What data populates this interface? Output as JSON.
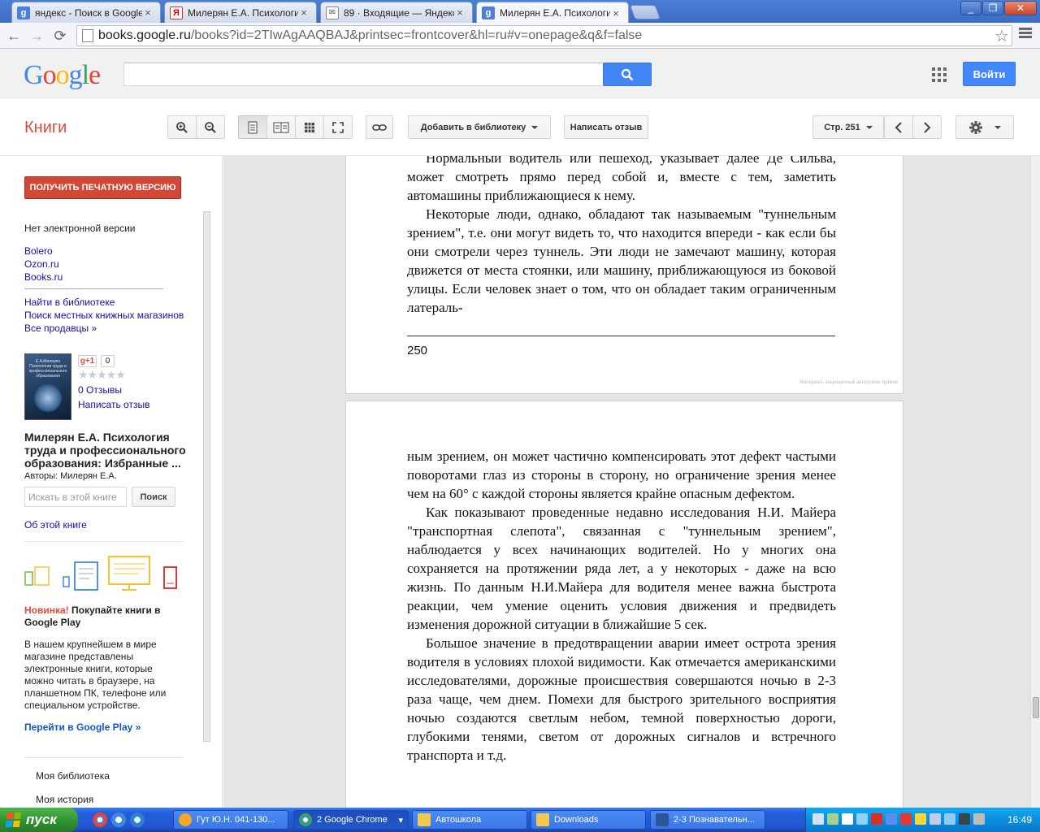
{
  "browser": {
    "tabs": [
      {
        "title": "яндекс - Поиск в Google",
        "favicon": "google-g-icon",
        "favicon_color": "#4d7fe0"
      },
      {
        "title": "Милерян Е.А. Психология т",
        "favicon": "yandex-icon",
        "favicon_color": "#ffffff"
      },
      {
        "title": "89 · Входящие — Яндекс.П",
        "favicon": "mail-icon",
        "favicon_color": "#ffffff"
      },
      {
        "title": "Милерян Е.А. Психология т",
        "favicon": "google-g-icon",
        "favicon_color": "#4d7fe0",
        "active": true
      }
    ],
    "url_host": "books.google.ru",
    "url_rest": "/books?id=2TIwAgAAQBAJ&printsec=frontcover&hl=ru#v=onepage&q&f=false"
  },
  "google": {
    "logo_letters": [
      "G",
      "o",
      "o",
      "g",
      "l",
      "e"
    ],
    "logo_colors": [
      "#4285f4",
      "#ea4335",
      "#fbbc05",
      "#4285f4",
      "#34a853",
      "#ea4335"
    ],
    "search_placeholder": "",
    "signin_label": "Войти"
  },
  "books_toolbar": {
    "section_title": "Книги",
    "add_to_library": "Добавить в библиотеку",
    "write_review": "Написать отзыв",
    "page_selector": "Стр. 251"
  },
  "sidebar": {
    "get_print": "ПОЛУЧИТЬ ПЕЧАТНУЮ ВЕРСИЮ",
    "no_ebook": "Нет электронной версии",
    "sellers": [
      "Bolero",
      "Ozon.ru",
      "Books.ru"
    ],
    "find_links": [
      "Найти в библиотеке",
      "Поиск местных книжных магазинов",
      "Все продавцы »"
    ],
    "cover_title": "Е.А.Милерян\nПсихология труда и профессионального образования",
    "gplus_label": "g+1",
    "gplus_count": "0",
    "stars": "★★★★★",
    "reviews_count": "0 Отзывы",
    "write_review": "Написать отзыв",
    "book_title": "Милерян Е.А. Психология труда и профессионального образования: Избранные ...",
    "authors": "Авторы: Милерян Е.А.",
    "search_in_book_placeholder": "Искать в этой книге",
    "search_button": "Поиск",
    "about_book": "Об этой книге",
    "promo_new": "Новинка!",
    "promo_headline": " Покупайте книги в Google Play",
    "promo_body": "В нашем крупнейшем в мире магазине представлены электронные книги, которые можно читать в браузере, на планшетном ПК, телефоне или специальном устройстве.",
    "promo_link": "Перейти в Google Play »",
    "bottom_links": [
      "Моя библиотека",
      "Моя история"
    ]
  },
  "reader": {
    "page1_paragraphs": [
      "Нормальный водитель или пешеход, указывает далее Де Сильва, может смотреть прямо перед собой и, вместе с тем, заметить автомашины приближающиеся к нему.",
      "Некоторые люди, однако, обладают так называемым \"туннельным зрением\", т.е. они могут видеть то, что находится впереди - как если бы они смотрели через туннель. Эти люди не замечают машину, которая движется от места стоянки, или машину, приближающуюся из боковой улицы. Если человек знает о том, что он обладает таким ограниченным латераль-"
    ],
    "page1_number": "250",
    "page1_copyright": "Материал, защищенный авторским правом",
    "page2_paragraphs": [
      "ным зрением, он может частично компенсировать этот дефект частыми поворотами глаз из стороны в сторону, но ограничение зрения менее чем на 60° с каждой стороны является крайне опасным дефектом.",
      "Как показывают проведенные недавно исследования Н.И. Майера \"транспортная слепота\", связанная с \"туннельным зрением\", наблюдается у всех начинающих водителей. Но у многих она сохраняется на протяжении ряда лет, а у некоторых - даже на всю жизнь. По данным Н.И.Майера для водителя менее важна быстрота реакции, чем умение оценить условия движения и предвидеть изменения дорожной ситуации в ближайшие 5 сек.",
      "Большое значение в предотвращении аварии имеет острота зрения водителя в условиях плохой видимости. Как отмечается американскими исследователями, дорожные происшествия совершаются ночью в 2-3 раза чаще, чем днем. Помехи для быстрого зрительного восприятия ночью создаются светлым небом, темной поверхностью дороги, глубокими тенями, светом от дорожных сигналов и встречного транспорта и т.д."
    ]
  },
  "taskbar": {
    "start_label": "пуск",
    "tasks": [
      {
        "label": "Гут Ю.Н. 041-130...",
        "icon": "smiley-icon",
        "color": "#f5a623"
      },
      {
        "label": "2 Google Chrome",
        "icon": "chrome-icon",
        "color": "#4caf50",
        "active": true
      },
      {
        "label": "Автошкола",
        "icon": "folder-icon",
        "color": "#f2c94c"
      },
      {
        "label": "Downloads",
        "icon": "folder-icon",
        "color": "#f2c94c"
      },
      {
        "label": "2-3 Познавательн...",
        "icon": "word-doc-icon",
        "color": "#2b579a"
      }
    ],
    "clock": "16:49"
  }
}
